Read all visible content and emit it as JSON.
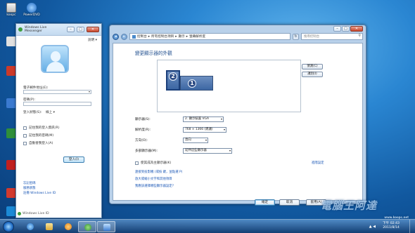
{
  "desktop": {
    "icons": [
      {
        "label": "koopc",
        "color": "#d8d8d8",
        "icon": "computer-icon"
      },
      {
        "label": "PowerDVD",
        "color": "#1d67c0",
        "icon": "powerdvd-icon"
      },
      {
        "label": "",
        "color": "#cc3a2a",
        "icon": "app-icon"
      },
      {
        "label": "",
        "color": "#3a7ad0",
        "icon": "app-icon"
      },
      {
        "label": "",
        "color": "#e0b020",
        "icon": "app-icon"
      },
      {
        "label": "",
        "color": "#2f8f3a",
        "icon": "app-icon"
      },
      {
        "label": "",
        "color": "#d23a2e",
        "icon": "app-icon"
      },
      {
        "label": "",
        "color": "#b02020",
        "icon": "app-icon"
      },
      {
        "label": "",
        "color": "#1b8ad6",
        "icon": "app-icon"
      }
    ]
  },
  "messenger": {
    "title": "Windows Live Messenger",
    "header_link": "說明 ▾",
    "email_label": "電子郵件地址(E):",
    "password_label": "密碼(P):",
    "status_label": "登入狀態(S):",
    "status_value": "線上 ▾",
    "options": [
      "記住我的登入資訊(R)",
      "記住我的密碼(M)",
      "自動替我登入(A)"
    ],
    "signin_button": "登入(I)",
    "links": [
      "忘記密碼",
      "服務狀態",
      "註冊 Windows Live ID"
    ],
    "brand": "Windows Live ID"
  },
  "control_panel": {
    "breadcrumb": [
      "控制台",
      "所有控制台項目",
      "顯示",
      "螢幕解析度"
    ],
    "search_placeholder": "搜尋控制台",
    "page_title": "變更顯示器的外觀",
    "monitor_badges": [
      "2",
      "1"
    ],
    "side_buttons": [
      "偵測(C)",
      "識別(I)"
    ],
    "rows": [
      {
        "label": "顯示器(S):",
        "value": "2. 顯示裝置 VGA"
      },
      {
        "label": "解析度(R):",
        "value": "768 × 1366 (建議)"
      },
      {
        "label": "方向(O):",
        "value": "直向"
      },
      {
        "label": "多部顯示器(M):",
        "value": "延伸這些顯示器"
      }
    ],
    "main_display_option": "使其成為主顯示器(K)",
    "advanced_link": "進階設定",
    "links": [
      "連接到投影機 (或按  鍵，並點選 P)",
      "放大或縮小文字和其他項目",
      "我應該選擇哪些顯示器設定?"
    ],
    "buttons": {
      "ok": "確定",
      "cancel": "取消",
      "apply": "套用(A)"
    }
  },
  "taskbar": {
    "time": "下午 02:43",
    "date": "2011/8/14",
    "tray": "▲ ◀"
  },
  "watermark": {
    "text": "電腦王阿達",
    "url": "www.koopc.net"
  },
  "colors": {
    "accent": "#1f4e8e",
    "link": "#1a57b6",
    "taskbar": "#143c6e"
  }
}
